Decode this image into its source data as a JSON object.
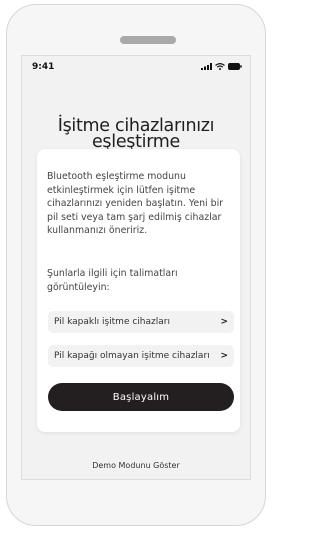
{
  "status_bar": {
    "time": "9:41",
    "icons": [
      "signal-icon",
      "wifi-icon",
      "battery-icon"
    ]
  },
  "title": {
    "line1": "İşitme cihazlarınızı",
    "line2": "eşleştirme"
  },
  "card": {
    "body": "Bluetooth eşleştirme modunu etkinleştirmek için lütfen işitme cihazlarınızı yeniden başlatın. Yeni bir pil seti veya tam şarj edilmiş cihazlar kullanmanızı öneririz.",
    "instructions_label": "Şunlarla ilgili için talimatları görüntüleyin:",
    "options": [
      {
        "label": "Pil kapaklı işitme cihazları",
        "chevron": ">"
      },
      {
        "label": "Pil kapağı olmayan işitme cihazları",
        "chevron": ">"
      }
    ],
    "primary_button": "Başlayalım"
  },
  "demo_link": "Demo Modunu Göster",
  "colors": {
    "primary_button_bg": "#231f20",
    "screen_bg": "#f2f2f2",
    "card_bg": "#ffffff"
  }
}
